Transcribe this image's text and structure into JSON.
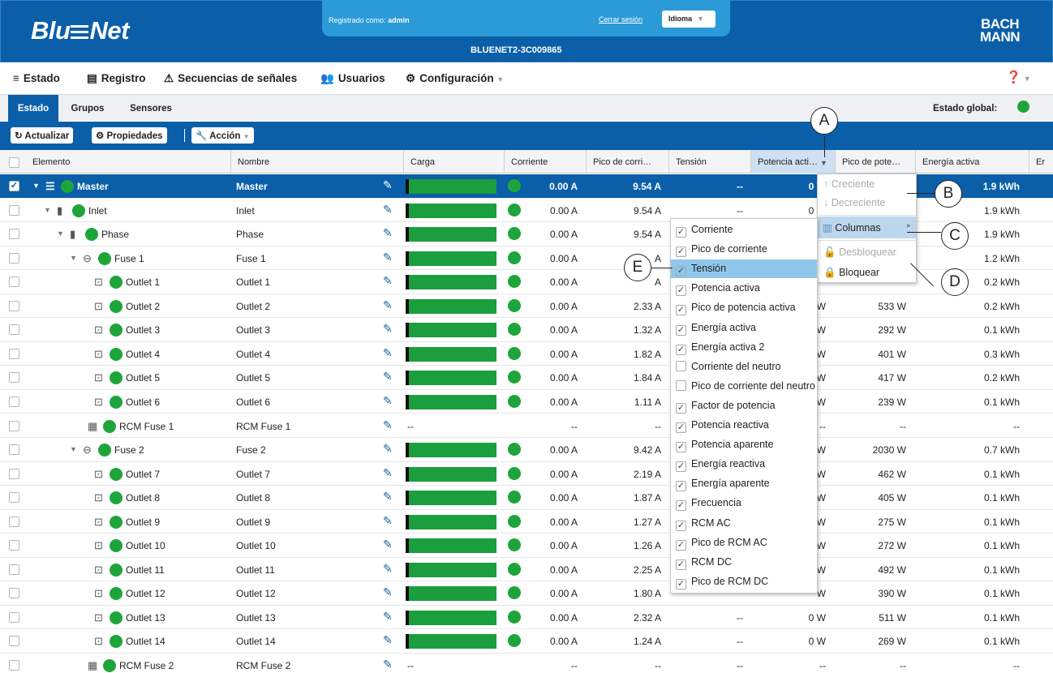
{
  "header": {
    "logo_left": "Blu",
    "logo_right": "Net",
    "registered_label": "Registrado como:",
    "user": "admin",
    "logout": "Cerrar sesión",
    "language": "Idioma",
    "device": "BLUENET2-3C009865",
    "brand_line1": "BACH",
    "brand_line2": "MANN"
  },
  "menu": {
    "estado": "Estado",
    "registro": "Registro",
    "secuencias": "Secuencias de señales",
    "usuarios": "Usuarios",
    "configuracion": "Configuración"
  },
  "tabs": {
    "estado": "Estado",
    "grupos": "Grupos",
    "sensores": "Sensores",
    "global_label": "Estado global:"
  },
  "toolbar": {
    "actualizar": "Actualizar",
    "propiedades": "Propiedades",
    "accion": "Acción"
  },
  "columns": {
    "elemento": "Elemento",
    "nombre": "Nombre",
    "carga": "Carga",
    "corriente": "Corriente",
    "pico_corriente": "Pico de corri…",
    "tension": "Tensión",
    "potencia": "Potencia acti…",
    "pico_potencia": "Pico de pote…",
    "energia": "Energía activa",
    "next": "Er"
  },
  "rows": [
    {
      "name": "Master",
      "nombre": "Master",
      "corriente": "0.00 A",
      "pico": "9.54 A",
      "tension": "--",
      "potencia": "0 W",
      "pico_pot": "",
      "energia": "1.9 kWh"
    },
    {
      "name": "Inlet",
      "nombre": "Inlet",
      "corriente": "0.00 A",
      "pico": "9.54 A",
      "tension": "--",
      "potencia": "0 W",
      "pico_pot": "",
      "energia": "1.9 kWh"
    },
    {
      "name": "Phase",
      "nombre": "Phase",
      "corriente": "0.00 A",
      "pico": "9.54 A",
      "tension": "",
      "potencia": "",
      "pico_pot": "",
      "energia": "1.9 kWh"
    },
    {
      "name": "Fuse 1",
      "nombre": "Fuse 1",
      "corriente": "0.00 A",
      "pico": "A",
      "tension": "",
      "potencia": "",
      "pico_pot": "",
      "energia": "1.2 kWh"
    },
    {
      "name": "Outlet 1",
      "nombre": "Outlet 1",
      "corriente": "0.00 A",
      "pico": "A",
      "tension": "",
      "potencia": "",
      "pico_pot": "",
      "energia": "0.2 kWh"
    },
    {
      "name": "Outlet 2",
      "nombre": "Outlet 2",
      "corriente": "0.00 A",
      "pico": "2.33 A",
      "tension": "",
      "potencia": "W",
      "pico_pot": "533 W",
      "energia": "0.2 kWh"
    },
    {
      "name": "Outlet 3",
      "nombre": "Outlet 3",
      "corriente": "0.00 A",
      "pico": "1.32 A",
      "tension": "",
      "potencia": "W",
      "pico_pot": "292 W",
      "energia": "0.1 kWh"
    },
    {
      "name": "Outlet 4",
      "nombre": "Outlet 4",
      "corriente": "0.00 A",
      "pico": "1.82 A",
      "tension": "",
      "potencia": "W",
      "pico_pot": "401 W",
      "energia": "0.3 kWh"
    },
    {
      "name": "Outlet 5",
      "nombre": "Outlet 5",
      "corriente": "0.00 A",
      "pico": "1.84 A",
      "tension": "",
      "potencia": "W",
      "pico_pot": "417 W",
      "energia": "0.2 kWh"
    },
    {
      "name": "Outlet 6",
      "nombre": "Outlet 6",
      "corriente": "0.00 A",
      "pico": "1.11 A",
      "tension": "",
      "potencia": "W",
      "pico_pot": "239 W",
      "energia": "0.1 kWh"
    },
    {
      "name": "RCM Fuse 1",
      "nombre": "RCM Fuse 1",
      "corriente": "--",
      "pico": "--",
      "tension": "",
      "potencia": "--",
      "pico_pot": "--",
      "energia": "--"
    },
    {
      "name": "Fuse 2",
      "nombre": "Fuse 2",
      "corriente": "0.00 A",
      "pico": "9.42 A",
      "tension": "",
      "potencia": "W",
      "pico_pot": "2030 W",
      "energia": "0.7 kWh"
    },
    {
      "name": "Outlet 7",
      "nombre": "Outlet 7",
      "corriente": "0.00 A",
      "pico": "2.19 A",
      "tension": "",
      "potencia": "W",
      "pico_pot": "462 W",
      "energia": "0.1 kWh"
    },
    {
      "name": "Outlet 8",
      "nombre": "Outlet 8",
      "corriente": "0.00 A",
      "pico": "1.87 A",
      "tension": "",
      "potencia": "W",
      "pico_pot": "405 W",
      "energia": "0.1 kWh"
    },
    {
      "name": "Outlet 9",
      "nombre": "Outlet 9",
      "corriente": "0.00 A",
      "pico": "1.27 A",
      "tension": "",
      "potencia": "W",
      "pico_pot": "275 W",
      "energia": "0.1 kWh"
    },
    {
      "name": "Outlet 10",
      "nombre": "Outlet 10",
      "corriente": "0.00 A",
      "pico": "1.26 A",
      "tension": "",
      "potencia": "W",
      "pico_pot": "272 W",
      "energia": "0.1 kWh"
    },
    {
      "name": "Outlet 11",
      "nombre": "Outlet 11",
      "corriente": "0.00 A",
      "pico": "2.25 A",
      "tension": "",
      "potencia": "W",
      "pico_pot": "492 W",
      "energia": "0.1 kWh"
    },
    {
      "name": "Outlet 12",
      "nombre": "Outlet 12",
      "corriente": "0.00 A",
      "pico": "1.80 A",
      "tension": "",
      "potencia": "W",
      "pico_pot": "390 W",
      "energia": "0.1 kWh"
    },
    {
      "name": "Outlet 13",
      "nombre": "Outlet 13",
      "corriente": "0.00 A",
      "pico": "2.32 A",
      "tension": "--",
      "potencia": "0 W",
      "pico_pot": "511 W",
      "energia": "0.1 kWh"
    },
    {
      "name": "Outlet 14",
      "nombre": "Outlet 14",
      "corriente": "0.00 A",
      "pico": "1.24 A",
      "tension": "--",
      "potencia": "0 W",
      "pico_pot": "269 W",
      "energia": "0.1 kWh"
    },
    {
      "name": "RCM Fuse 2",
      "nombre": "RCM Fuse 2",
      "corriente": "--",
      "pico": "--",
      "tension": "--",
      "potencia": "--",
      "pico_pot": "--",
      "energia": "--"
    }
  ],
  "sort_menu": {
    "creciente": "Creciente",
    "decreciente": "Decreciente",
    "columnas": "Columnas",
    "desbloquear": "Desbloquear",
    "bloquear": "Bloquear"
  },
  "columns_menu": [
    {
      "label": "Corriente",
      "checked": true
    },
    {
      "label": "Pico de corriente",
      "checked": true
    },
    {
      "label": "Tensión",
      "checked": true
    },
    {
      "label": "Potencia activa",
      "checked": true
    },
    {
      "label": "Pico de potencia activa",
      "checked": true
    },
    {
      "label": "Energía activa",
      "checked": true
    },
    {
      "label": "Energía activa 2",
      "checked": true
    },
    {
      "label": "Corriente del neutro",
      "checked": false
    },
    {
      "label": "Pico de corriente del neutro",
      "checked": false
    },
    {
      "label": "Factor de potencia",
      "checked": true
    },
    {
      "label": "Potencia reactiva",
      "checked": true
    },
    {
      "label": "Potencia aparente",
      "checked": true
    },
    {
      "label": "Energía reactiva",
      "checked": true
    },
    {
      "label": "Energía aparente",
      "checked": true
    },
    {
      "label": "Frecuencia",
      "checked": true
    },
    {
      "label": "RCM AC",
      "checked": true
    },
    {
      "label": "Pico de RCM AC",
      "checked": true
    },
    {
      "label": "RCM DC",
      "checked": true
    },
    {
      "label": "Pico de RCM DC",
      "checked": true
    }
  ],
  "callouts": {
    "a": "A",
    "b": "B",
    "c": "C",
    "d": "D",
    "e": "E"
  },
  "colors": {
    "brand_blue": "#0a5fa8",
    "header_pill": "#2b9bd8",
    "status_green": "#1ea53a",
    "selection": "#cfe0f2"
  }
}
